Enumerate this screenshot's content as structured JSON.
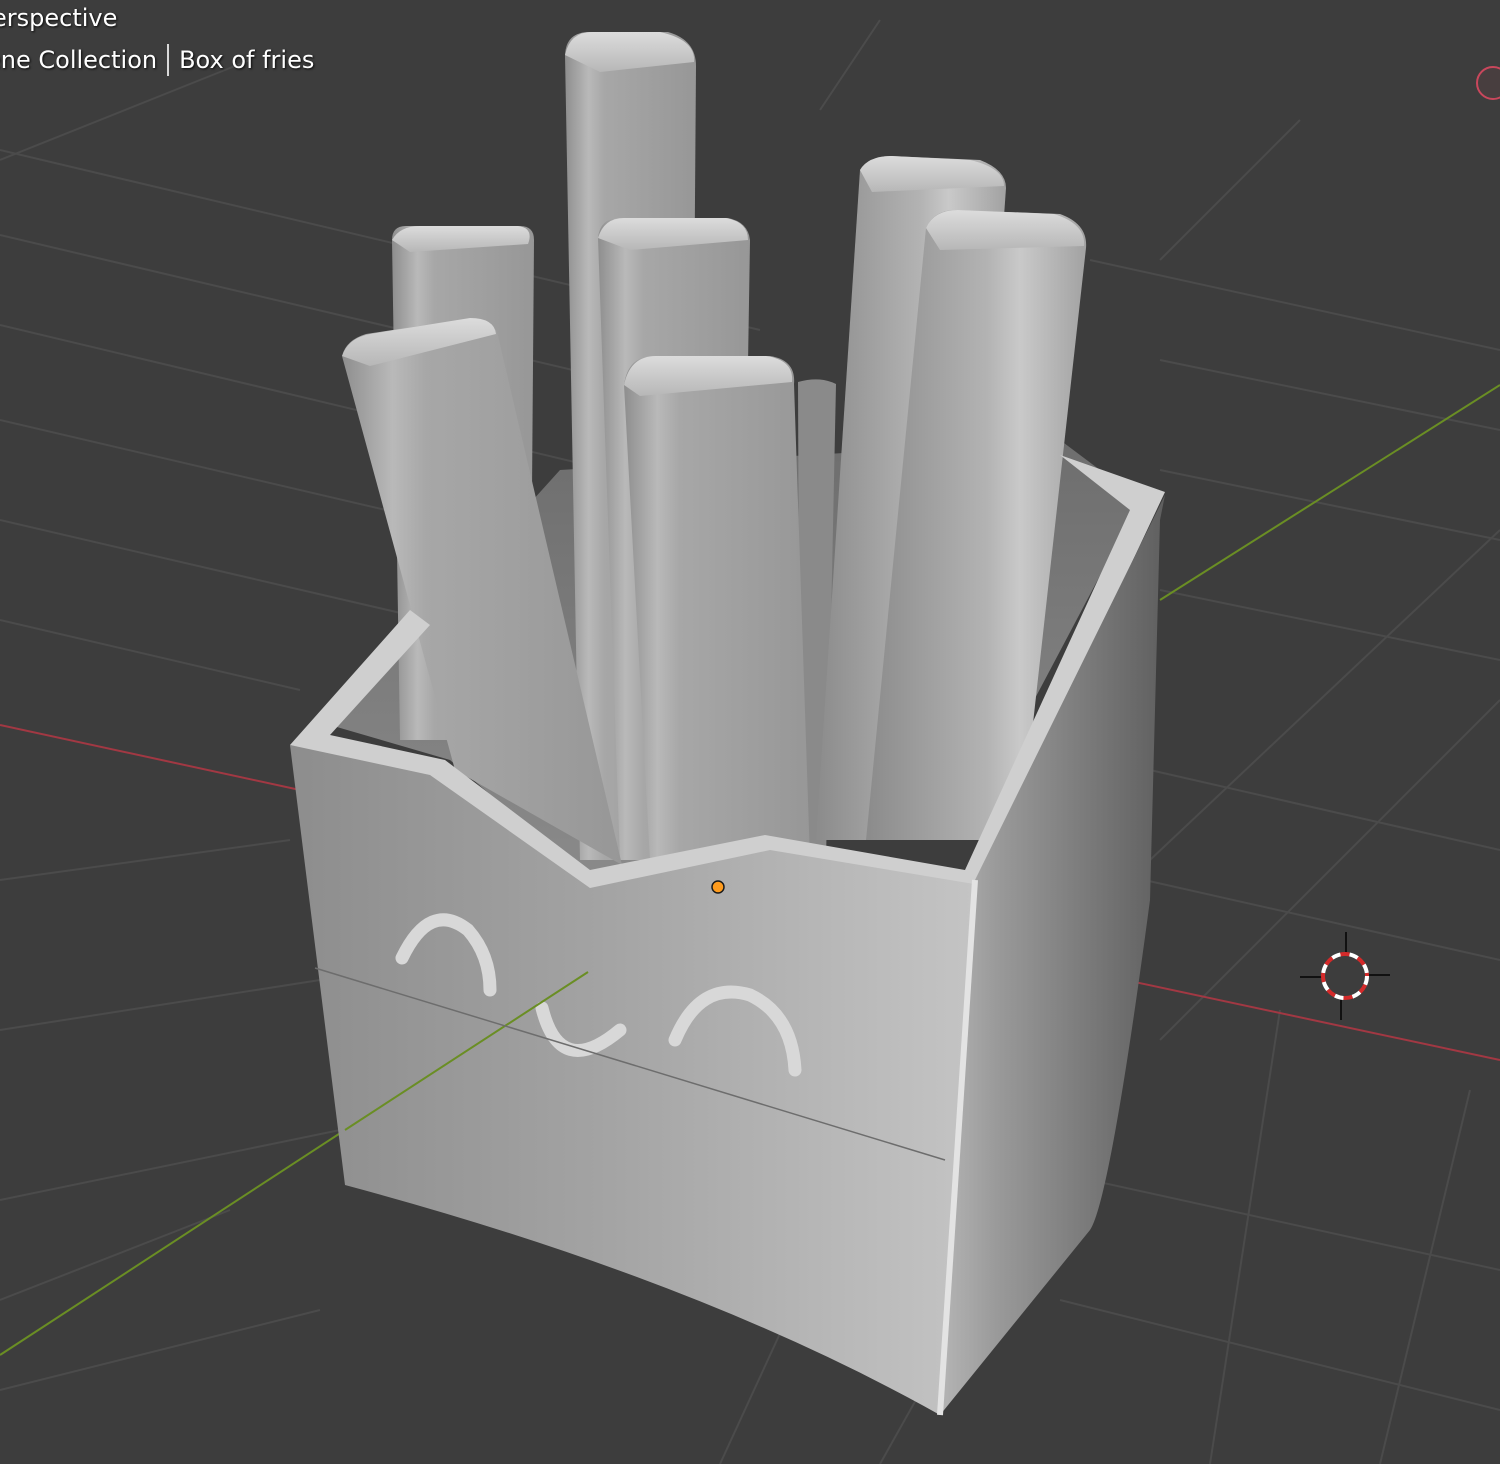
{
  "viewport": {
    "view_label": "erspective",
    "breadcrumb": {
      "collection": "ene Collection",
      "object": "Box of fries"
    }
  },
  "colors": {
    "background": "#3d3d3d",
    "grid_line": "#4a4a4a",
    "x_axis": "#a23843",
    "y_axis": "#6a8e24",
    "model_gray": "#9a9a9a",
    "origin_dot": "#ff9c1e",
    "cursor_red": "#d42a2a"
  },
  "icons": {
    "record": "record-circle-icon",
    "cursor": "3d-cursor-icon",
    "origin": "object-origin-dot-icon"
  }
}
